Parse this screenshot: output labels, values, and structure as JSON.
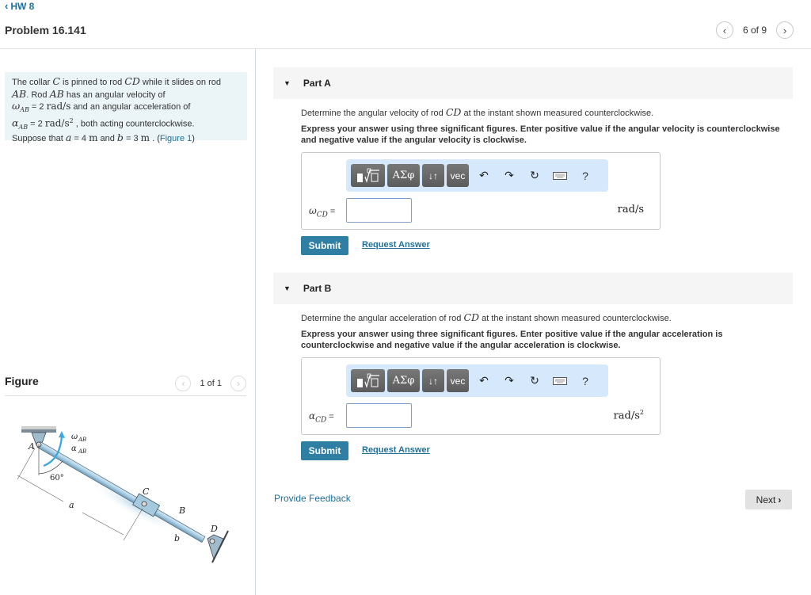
{
  "nav": {
    "back_label": "HW 8",
    "back_icon": "chevron-left-icon",
    "problem_title": "Problem 16.141",
    "pager_text": "6 of 9",
    "prev_icon": "chevron-left-icon",
    "next_icon": "chevron-right-icon"
  },
  "problem": {
    "t1": "The collar ",
    "m_C": "C",
    "t2": " is pinned to rod ",
    "m_CD": "CD",
    "t3": " while it slides on rod ",
    "m_AB1": "AB",
    "t4": ". Rod ",
    "m_AB2": "AB",
    "t5": " has an angular velocity of",
    "omega_ab": "ω",
    "omega_ab_sub": "AB",
    "omega_value": " = 2 ",
    "omega_unit": "rad/s",
    "t6": " and an angular acceleration of",
    "alpha_ab": "α",
    "alpha_ab_sub": "AB",
    "alpha_value": " = 2 ",
    "alpha_unit": "rad/s",
    "alpha_unit_sup": "2",
    "t7": " , both acting counterclockwise.",
    "t8": "Suppose that ",
    "m_a": "a",
    "a_value": " = 4 ",
    "a_unit": "m",
    "t9": " and ",
    "m_b": "b",
    "b_value": " = 3 ",
    "b_unit": "m",
    "t10": " . (",
    "figure_link": "Figure 1",
    "t11": ")"
  },
  "figure": {
    "title": "Figure",
    "pager_text": "1 of 1",
    "labels": {
      "A": "A",
      "B": "B",
      "C": "C",
      "D": "D",
      "omega": "ω",
      "alpha": "α",
      "sub": "AB",
      "angle": "60°",
      "a": "a",
      "b": "b"
    },
    "accent_color": "#3aa8e0"
  },
  "parts": [
    {
      "label": "Part A",
      "question_pre": "Determine the angular velocity of rod ",
      "question_math": "CD",
      "question_post": " at the instant shown measured counterclockwise.",
      "instructions": "Express your answer using three significant figures. Enter positive value if the angular velocity is counterclockwise and negative value if the angular velocity is clockwise.",
      "var_symbol": "ω",
      "var_sub": "CD",
      "var_eq": "=",
      "input_value": "",
      "unit": "rad/s",
      "unit_sup": "",
      "submit_label": "Submit",
      "request_label": "Request Answer"
    },
    {
      "label": "Part B",
      "question_pre": "Determine the angular acceleration of rod ",
      "question_math": "CD",
      "question_post": " at the instant shown measured counterclockwise.",
      "instructions": "Express your answer using three significant figures. Enter positive value if the angular acceleration is counterclockwise and negative value if the angular acceleration is clockwise.",
      "var_symbol": "α",
      "var_sub": "CD",
      "var_eq": "=",
      "input_value": "",
      "unit": "rad/s",
      "unit_sup": "2",
      "submit_label": "Submit",
      "request_label": "Request Answer"
    }
  ],
  "toolbar": {
    "greek_label": "ΑΣφ",
    "arrows_label": "↓↑",
    "vec_label": "vec",
    "help_label": "?",
    "undo_icon": "undo-icon",
    "redo_icon": "redo-icon",
    "reset_icon": "reset-icon",
    "keyboard_icon": "keyboard-icon"
  },
  "footer": {
    "feedback_label": "Provide Feedback",
    "next_label": "Next"
  },
  "colors": {
    "link": "#1f6f9b",
    "submit": "#2f7ea4",
    "problem_bg": "#ebf5f8",
    "toolbar_bg": "#d6e8fb"
  }
}
